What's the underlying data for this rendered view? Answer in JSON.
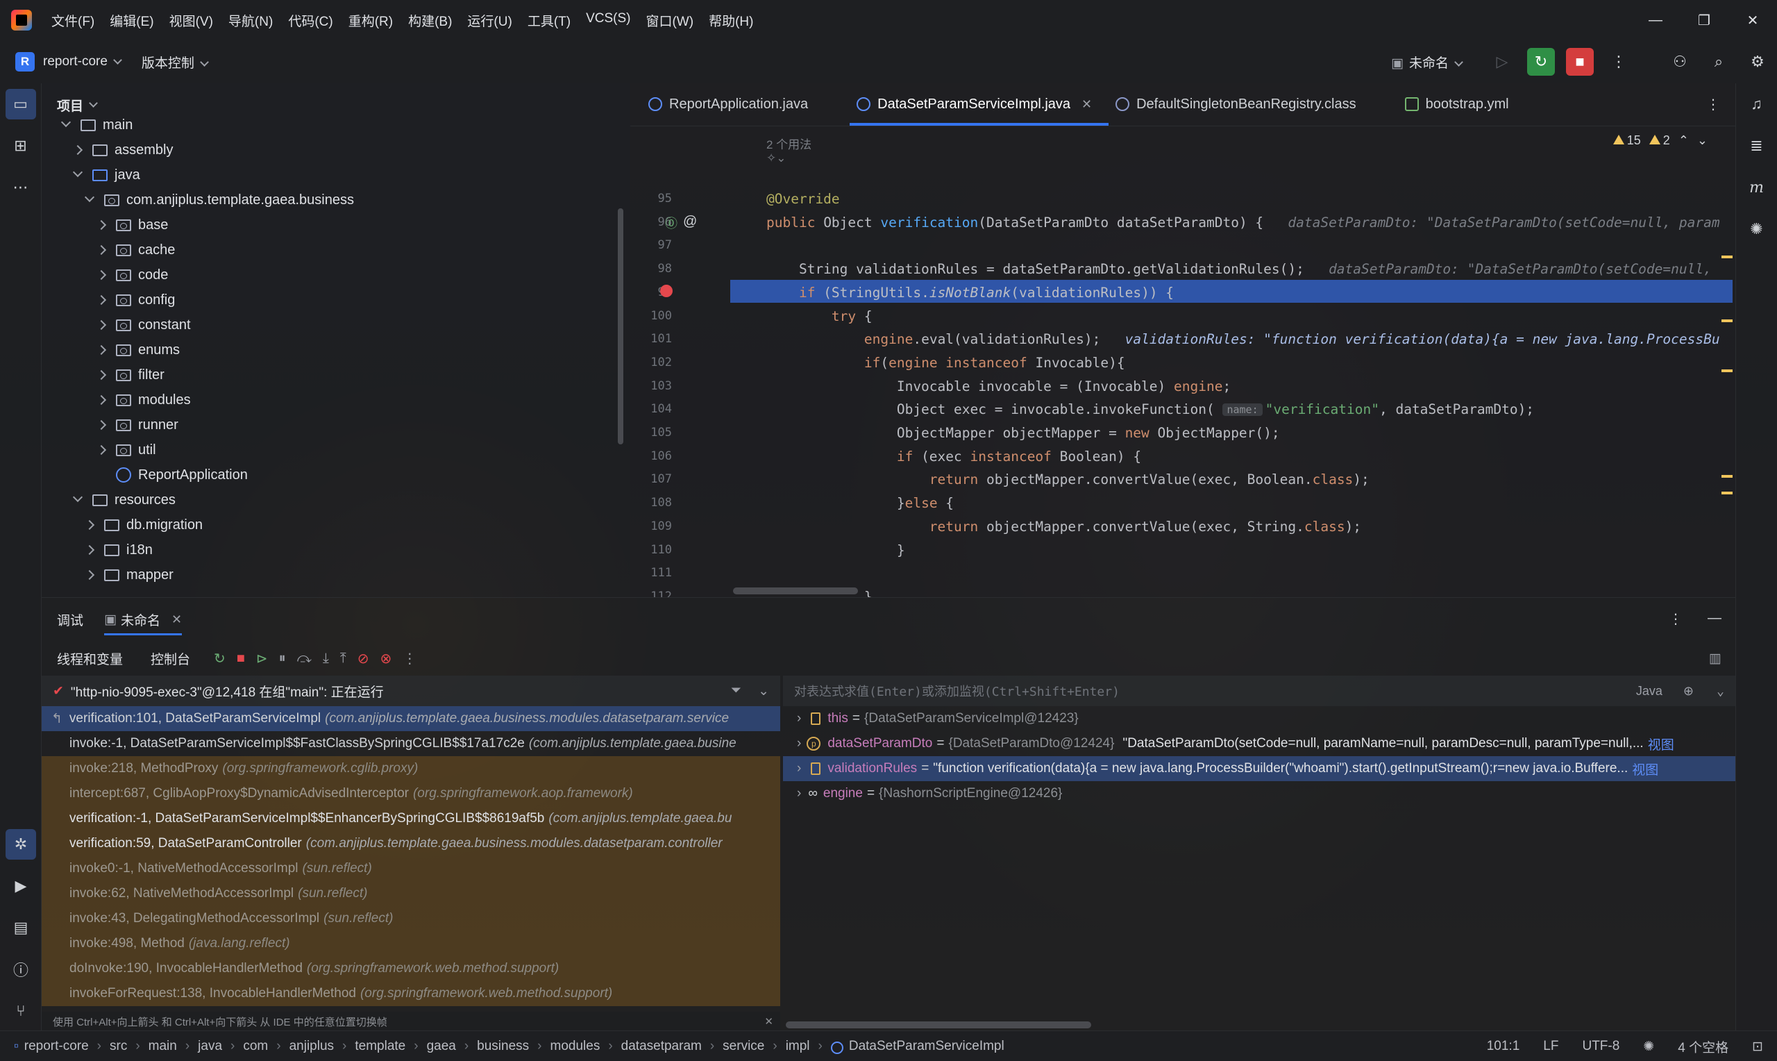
{
  "menubar": {
    "items": [
      "文件(F)",
      "编辑(E)",
      "视图(V)",
      "导航(N)",
      "代码(C)",
      "重构(R)",
      "构建(B)",
      "运行(U)",
      "工具(T)",
      "VCS(S)",
      "窗口(W)",
      "帮助(H)"
    ]
  },
  "toolbar": {
    "project_badge": "R",
    "project_name": "report-core",
    "vcs_label": "版本控制",
    "run_config": "未命名"
  },
  "project_panel": {
    "title": "项目",
    "tree": [
      {
        "label": "main",
        "depth": 0,
        "state": "open",
        "kind": "folder"
      },
      {
        "label": "assembly",
        "depth": 1,
        "state": "closed",
        "kind": "folder"
      },
      {
        "label": "java",
        "depth": 1,
        "state": "open",
        "kind": "folder-blue"
      },
      {
        "label": "com.anjiplus.template.gaea.business",
        "depth": 2,
        "state": "open",
        "kind": "package"
      },
      {
        "label": "base",
        "depth": 3,
        "state": "closed",
        "kind": "package"
      },
      {
        "label": "cache",
        "depth": 3,
        "state": "closed",
        "kind": "package"
      },
      {
        "label": "code",
        "depth": 3,
        "state": "closed",
        "kind": "package"
      },
      {
        "label": "config",
        "depth": 3,
        "state": "closed",
        "kind": "package"
      },
      {
        "label": "constant",
        "depth": 3,
        "state": "closed",
        "kind": "package"
      },
      {
        "label": "enums",
        "depth": 3,
        "state": "closed",
        "kind": "package"
      },
      {
        "label": "filter",
        "depth": 3,
        "state": "closed",
        "kind": "package"
      },
      {
        "label": "modules",
        "depth": 3,
        "state": "closed",
        "kind": "package"
      },
      {
        "label": "runner",
        "depth": 3,
        "state": "closed",
        "kind": "package"
      },
      {
        "label": "util",
        "depth": 3,
        "state": "closed",
        "kind": "package"
      },
      {
        "label": "ReportApplication",
        "depth": 3,
        "state": "none",
        "kind": "class"
      },
      {
        "label": "resources",
        "depth": 1,
        "state": "open",
        "kind": "folder"
      },
      {
        "label": "db.migration",
        "depth": 2,
        "state": "closed",
        "kind": "folder"
      },
      {
        "label": "i18n",
        "depth": 2,
        "state": "closed",
        "kind": "folder"
      },
      {
        "label": "mapper",
        "depth": 2,
        "state": "closed",
        "kind": "folder"
      }
    ]
  },
  "editor": {
    "tabs": [
      {
        "label": "ReportApplication.java",
        "icon": "class",
        "active": false
      },
      {
        "label": "DataSetParamServiceImpl.java",
        "icon": "class",
        "active": true
      },
      {
        "label": "DefaultSingletonBeanRegistry.class",
        "icon": "class-file",
        "active": false
      },
      {
        "label": "bootstrap.yml",
        "icon": "yml",
        "active": false
      }
    ],
    "warnings_count": "15",
    "weak_warnings_count": "2",
    "usages_hint": "2 个用法",
    "lines": [
      {
        "n": "95",
        "html": "<span class='an'>@Override</span>"
      },
      {
        "n": "96",
        "html": "<span class='kw'>public</span><span class='pl'> Object </span><span class='fn'>verification</span><span class='pl'>(DataSetParamDto dataSetParamDto) {   </span><span class='inline-val'>dataSetParamDto: \"DataSetParamDto(setCode=null, param</span>"
      },
      {
        "n": "97",
        "html": ""
      },
      {
        "n": "98",
        "html": "<span class='pl'>    String validationRules = dataSetParamDto.getValidationRules();   </span><span class='inline-val'>dataSetParamDto: \"DataSetParamDto(setCode=null,</span>"
      },
      {
        "n": "99",
        "html": "<span class='kw'>    if</span><span class='pl'> (StringUtils.</span><span class='pl it'>isNotBlank</span><span class='pl'>(validationRules)) {</span>"
      },
      {
        "n": "100",
        "html": "<span class='kw'>        try</span><span class='pl'> {</span>"
      },
      {
        "n": "101",
        "html": "<span class='pl'>            </span><span class='kw'>engine</span><span class='pl'>.eval(validationRules);   </span><span class='inline-val'>validationRules: \"function verification(data){a = new java.lang.ProcessBu</span>"
      },
      {
        "n": "102",
        "html": "<span class='kw'>            if</span><span class='pl'>(</span><span class='kw'>engine instanceof</span><span class='pl'> Invocable){</span>"
      },
      {
        "n": "103",
        "html": "<span class='pl'>                Invocable invocable = (Invocable) </span><span class='kw'>engine</span><span class='pl'>;</span>"
      },
      {
        "n": "104",
        "html": "<span class='pl'>                Object exec = invocable.invokeFunction( </span><span class='hint'>name:</span><span class='st'>\"verification\"</span><span class='pl'>, dataSetParamDto);</span>"
      },
      {
        "n": "105",
        "html": "<span class='pl'>                ObjectMapper objectMapper = </span><span class='kw'>new</span><span class='pl'> ObjectMapper();</span>"
      },
      {
        "n": "106",
        "html": "<span class='kw'>                if</span><span class='pl'> (exec </span><span class='kw'>instanceof</span><span class='pl'> Boolean) {</span>"
      },
      {
        "n": "107",
        "html": "<span class='kw'>                    return</span><span class='pl'> objectMapper.convertValue(exec, Boolean.</span><span class='kw'>class</span><span class='pl'>);</span>"
      },
      {
        "n": "108",
        "html": "<span class='pl'>                }</span><span class='kw'>else</span><span class='pl'> {</span>"
      },
      {
        "n": "109",
        "html": "<span class='kw'>                    return</span><span class='pl'> objectMapper.convertValue(exec, String.</span><span class='kw'>class</span><span class='pl'>);</span>"
      },
      {
        "n": "110",
        "html": "<span class='pl'>                }</span>"
      },
      {
        "n": "111",
        "html": ""
      },
      {
        "n": "112",
        "html": "<span class='pl'>            }</span>"
      }
    ]
  },
  "debug": {
    "tab_debug": "调试",
    "tab_session": "未命名",
    "sub_threads": "线程和变量",
    "sub_console": "控制台",
    "thread_status": "\"http-nio-9095-exec-3\"@12,418 在组\"main\": 正在运行",
    "eval_placeholder": "对表达式求值(Enter)或添加监视(Ctrl+Shift+Enter)",
    "lang": "Java",
    "frames": [
      {
        "main": "verification:101, DataSetParamServiceImpl",
        "pkg": "(com.anjiplus.template.gaea.business.modules.datasetparam.service",
        "kind": "sel"
      },
      {
        "main": "invoke:-1, DataSetParamServiceImpl$$FastClassBySpringCGLIB$$17a17c2e",
        "pkg": "(com.anjiplus.template.gaea.busine",
        "kind": "user-plain"
      },
      {
        "main": "invoke:218, MethodProxy",
        "pkg": "(org.springframework.cglib.proxy)",
        "kind": "lib"
      },
      {
        "main": "intercept:687, CglibAopProxy$DynamicAdvisedInterceptor",
        "pkg": "(org.springframework.aop.framework)",
        "kind": "lib"
      },
      {
        "main": "verification:-1, DataSetParamServiceImpl$$EnhancerBySpringCGLIB$$8619af5b",
        "pkg": "(com.anjiplus.template.gaea.bu",
        "kind": "user"
      },
      {
        "main": "verification:59, DataSetParamController",
        "pkg": "(com.anjiplus.template.gaea.business.modules.datasetparam.controller",
        "kind": "user"
      },
      {
        "main": "invoke0:-1, NativeMethodAccessorImpl",
        "pkg": "(sun.reflect)",
        "kind": "lib"
      },
      {
        "main": "invoke:62, NativeMethodAccessorImpl",
        "pkg": "(sun.reflect)",
        "kind": "lib"
      },
      {
        "main": "invoke:43, DelegatingMethodAccessorImpl",
        "pkg": "(sun.reflect)",
        "kind": "lib"
      },
      {
        "main": "invoke:498, Method",
        "pkg": "(java.lang.reflect)",
        "kind": "lib"
      },
      {
        "main": "doInvoke:190, InvocableHandlerMethod",
        "pkg": "(org.springframework.web.method.support)",
        "kind": "lib"
      },
      {
        "main": "invokeForRequest:138, InvocableHandlerMethod",
        "pkg": "(org.springframework.web.method.support)",
        "kind": "lib"
      }
    ],
    "frames_hint": "使用 Ctrl+Alt+向上箭头 和 Ctrl+Alt+向下箭头 从 IDE 中的任意位置切换帧",
    "variables": [
      {
        "name": "this",
        "type": "{DataSetParamServiceImpl@12423}",
        "value": "",
        "link": "",
        "icon": "field",
        "sel": false
      },
      {
        "name": "dataSetParamDto",
        "type": "{DataSetParamDto@12424}",
        "value": "\"DataSetParamDto(setCode=null, paramName=null, paramDesc=null, paramType=null,...",
        "link": "视图",
        "icon": "param",
        "sel": false
      },
      {
        "name": "validationRules",
        "type": "",
        "value": "\"function verification(data){a = new java.lang.ProcessBuilder(\"whoami\").start().getInputStream();r=new java.io.Buffere...",
        "link": "视图",
        "icon": "field",
        "sel": true
      },
      {
        "name": "engine",
        "type": "{NashornScriptEngine@12426}",
        "value": "",
        "link": "",
        "icon": "oo",
        "sel": false
      }
    ]
  },
  "statusbar": {
    "breadcrumbs": [
      "report-core",
      "src",
      "main",
      "java",
      "com",
      "anjiplus",
      "template",
      "gaea",
      "business",
      "modules",
      "datasetparam",
      "service",
      "impl",
      "DataSetParamServiceImpl"
    ],
    "position": "101:1",
    "line_sep": "LF",
    "encoding": "UTF-8",
    "indent": "4 个空格"
  }
}
